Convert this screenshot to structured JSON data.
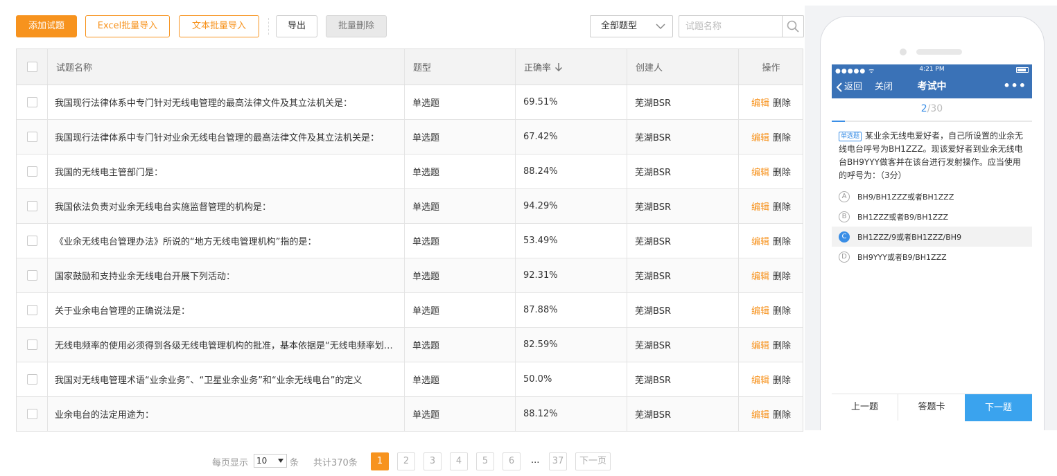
{
  "toolbar": {
    "add_label": "添加试题",
    "excel_import_label": "Excel批量导入",
    "text_import_label": "文本批量导入",
    "export_label": "导出",
    "batch_delete_label": "批量删除",
    "type_filter_value": "全部题型",
    "search_placeholder": "试题名称"
  },
  "table": {
    "headers": {
      "name": "试题名称",
      "type": "题型",
      "rate": "正确率",
      "creator": "创建人",
      "ops": "操作"
    },
    "rows": [
      {
        "name": "我国现行法律体系中专门针对无线电管理的最高法律文件及其立法机关是：",
        "type": "单选题",
        "rate": "69.51%",
        "creator": "芜湖BSR",
        "edit": "编辑",
        "delete": "删除"
      },
      {
        "name": "我国现行法律体系中专门针对业余无线电台管理的最高法律文件及其立法机关是：",
        "type": "单选题",
        "rate": "67.42%",
        "creator": "芜湖BSR",
        "edit": "编辑",
        "delete": "删除"
      },
      {
        "name": "我国的无线电主管部门是：",
        "type": "单选题",
        "rate": "88.24%",
        "creator": "芜湖BSR",
        "edit": "编辑",
        "delete": "删除"
      },
      {
        "name": "我国依法负责对业余无线电台实施监督管理的机构是：",
        "type": "单选题",
        "rate": "94.29%",
        "creator": "芜湖BSR",
        "edit": "编辑",
        "delete": "删除"
      },
      {
        "name": "《业余无线电台管理办法》所说的“地方无线电管理机构”指的是：",
        "type": "单选题",
        "rate": "53.49%",
        "creator": "芜湖BSR",
        "edit": "编辑",
        "delete": "删除"
      },
      {
        "name": "国家鼓励和支持业余无线电台开展下列活动：",
        "type": "单选题",
        "rate": "92.31%",
        "creator": "芜湖BSR",
        "edit": "编辑",
        "delete": "删除"
      },
      {
        "name": "关于业余电台管理的正确说法是：",
        "type": "单选题",
        "rate": "87.88%",
        "creator": "芜湖BSR",
        "edit": "编辑",
        "delete": "删除"
      },
      {
        "name": "无线电频率的使用必须得到各级无线电管理机构的批准，基本依据是“无线电频率划分规定”",
        "type": "单选题",
        "rate": "82.59%",
        "creator": "芜湖BSR",
        "edit": "编辑",
        "delete": "删除"
      },
      {
        "name": "我国对无线电管理术语“业余业务”、“卫星业余业务”和“业余无线电台”的定义",
        "type": "单选题",
        "rate": "50.0%",
        "creator": "芜湖BSR",
        "edit": "编辑",
        "delete": "删除"
      },
      {
        "name": "业余电台的法定用途为：",
        "type": "单选题",
        "rate": "88.12%",
        "creator": "芜湖BSR",
        "edit": "编辑",
        "delete": "删除"
      }
    ]
  },
  "pagination": {
    "per_page_label": "每页显示",
    "per_page_value": "10",
    "per_page_unit": "条",
    "total_label": "共计370条",
    "pages": [
      "1",
      "2",
      "3",
      "4",
      "5",
      "6"
    ],
    "current_page": "1",
    "ellipsis": "...",
    "last_page": "37",
    "next_label": "下一页"
  },
  "phone": {
    "status_signal": "●●●●● ᯤ",
    "status_time": "4:21 PM",
    "back_label": "返回",
    "close_label": "关闭",
    "title": "考试中",
    "more": "•••",
    "progress_current": "2",
    "progress_total": "/30",
    "progress_fraction": 0.067,
    "question_tag": "单选题",
    "question_text": "某业余无线电爱好者，自己所设置的业余无线电台呼号为BH1ZZZ。现该爱好者到业余无线电台BH9YYY做客并在该台进行发射操作。应当使用的呼号为：（3分）",
    "options": [
      {
        "letter": "A",
        "text": "BH9/BH1ZZZ或者BH1ZZZ",
        "selected": false
      },
      {
        "letter": "B",
        "text": "BH1ZZZ或者B9/BH1ZZZ",
        "selected": false
      },
      {
        "letter": "C",
        "text": "BH1ZZZ/9或者BH1ZZZ/BH9",
        "selected": true
      },
      {
        "letter": "D",
        "text": "BH9YYY或者B9/BH1ZZZ",
        "selected": false
      }
    ],
    "prev_label": "上一题",
    "card_label": "答题卡",
    "next_label": "下一题"
  },
  "colors": {
    "accent": "#f7931e",
    "phone_header": "#3a72b7",
    "phone_accent": "#3a8ee6",
    "next_button": "#3aa3ee"
  }
}
